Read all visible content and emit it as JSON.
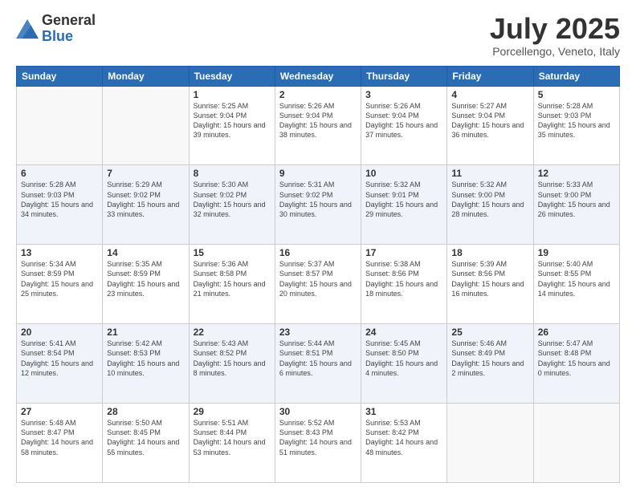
{
  "logo": {
    "general": "General",
    "blue": "Blue"
  },
  "header": {
    "month": "July 2025",
    "location": "Porcellengo, Veneto, Italy"
  },
  "weekdays": [
    "Sunday",
    "Monday",
    "Tuesday",
    "Wednesday",
    "Thursday",
    "Friday",
    "Saturday"
  ],
  "weeks": [
    [
      {
        "day": null,
        "sunrise": null,
        "sunset": null,
        "daylight": null
      },
      {
        "day": null,
        "sunrise": null,
        "sunset": null,
        "daylight": null
      },
      {
        "day": "1",
        "sunrise": "Sunrise: 5:25 AM",
        "sunset": "Sunset: 9:04 PM",
        "daylight": "Daylight: 15 hours and 39 minutes."
      },
      {
        "day": "2",
        "sunrise": "Sunrise: 5:26 AM",
        "sunset": "Sunset: 9:04 PM",
        "daylight": "Daylight: 15 hours and 38 minutes."
      },
      {
        "day": "3",
        "sunrise": "Sunrise: 5:26 AM",
        "sunset": "Sunset: 9:04 PM",
        "daylight": "Daylight: 15 hours and 37 minutes."
      },
      {
        "day": "4",
        "sunrise": "Sunrise: 5:27 AM",
        "sunset": "Sunset: 9:04 PM",
        "daylight": "Daylight: 15 hours and 36 minutes."
      },
      {
        "day": "5",
        "sunrise": "Sunrise: 5:28 AM",
        "sunset": "Sunset: 9:03 PM",
        "daylight": "Daylight: 15 hours and 35 minutes."
      }
    ],
    [
      {
        "day": "6",
        "sunrise": "Sunrise: 5:28 AM",
        "sunset": "Sunset: 9:03 PM",
        "daylight": "Daylight: 15 hours and 34 minutes."
      },
      {
        "day": "7",
        "sunrise": "Sunrise: 5:29 AM",
        "sunset": "Sunset: 9:02 PM",
        "daylight": "Daylight: 15 hours and 33 minutes."
      },
      {
        "day": "8",
        "sunrise": "Sunrise: 5:30 AM",
        "sunset": "Sunset: 9:02 PM",
        "daylight": "Daylight: 15 hours and 32 minutes."
      },
      {
        "day": "9",
        "sunrise": "Sunrise: 5:31 AM",
        "sunset": "Sunset: 9:02 PM",
        "daylight": "Daylight: 15 hours and 30 minutes."
      },
      {
        "day": "10",
        "sunrise": "Sunrise: 5:32 AM",
        "sunset": "Sunset: 9:01 PM",
        "daylight": "Daylight: 15 hours and 29 minutes."
      },
      {
        "day": "11",
        "sunrise": "Sunrise: 5:32 AM",
        "sunset": "Sunset: 9:00 PM",
        "daylight": "Daylight: 15 hours and 28 minutes."
      },
      {
        "day": "12",
        "sunrise": "Sunrise: 5:33 AM",
        "sunset": "Sunset: 9:00 PM",
        "daylight": "Daylight: 15 hours and 26 minutes."
      }
    ],
    [
      {
        "day": "13",
        "sunrise": "Sunrise: 5:34 AM",
        "sunset": "Sunset: 8:59 PM",
        "daylight": "Daylight: 15 hours and 25 minutes."
      },
      {
        "day": "14",
        "sunrise": "Sunrise: 5:35 AM",
        "sunset": "Sunset: 8:59 PM",
        "daylight": "Daylight: 15 hours and 23 minutes."
      },
      {
        "day": "15",
        "sunrise": "Sunrise: 5:36 AM",
        "sunset": "Sunset: 8:58 PM",
        "daylight": "Daylight: 15 hours and 21 minutes."
      },
      {
        "day": "16",
        "sunrise": "Sunrise: 5:37 AM",
        "sunset": "Sunset: 8:57 PM",
        "daylight": "Daylight: 15 hours and 20 minutes."
      },
      {
        "day": "17",
        "sunrise": "Sunrise: 5:38 AM",
        "sunset": "Sunset: 8:56 PM",
        "daylight": "Daylight: 15 hours and 18 minutes."
      },
      {
        "day": "18",
        "sunrise": "Sunrise: 5:39 AM",
        "sunset": "Sunset: 8:56 PM",
        "daylight": "Daylight: 15 hours and 16 minutes."
      },
      {
        "day": "19",
        "sunrise": "Sunrise: 5:40 AM",
        "sunset": "Sunset: 8:55 PM",
        "daylight": "Daylight: 15 hours and 14 minutes."
      }
    ],
    [
      {
        "day": "20",
        "sunrise": "Sunrise: 5:41 AM",
        "sunset": "Sunset: 8:54 PM",
        "daylight": "Daylight: 15 hours and 12 minutes."
      },
      {
        "day": "21",
        "sunrise": "Sunrise: 5:42 AM",
        "sunset": "Sunset: 8:53 PM",
        "daylight": "Daylight: 15 hours and 10 minutes."
      },
      {
        "day": "22",
        "sunrise": "Sunrise: 5:43 AM",
        "sunset": "Sunset: 8:52 PM",
        "daylight": "Daylight: 15 hours and 8 minutes."
      },
      {
        "day": "23",
        "sunrise": "Sunrise: 5:44 AM",
        "sunset": "Sunset: 8:51 PM",
        "daylight": "Daylight: 15 hours and 6 minutes."
      },
      {
        "day": "24",
        "sunrise": "Sunrise: 5:45 AM",
        "sunset": "Sunset: 8:50 PM",
        "daylight": "Daylight: 15 hours and 4 minutes."
      },
      {
        "day": "25",
        "sunrise": "Sunrise: 5:46 AM",
        "sunset": "Sunset: 8:49 PM",
        "daylight": "Daylight: 15 hours and 2 minutes."
      },
      {
        "day": "26",
        "sunrise": "Sunrise: 5:47 AM",
        "sunset": "Sunset: 8:48 PM",
        "daylight": "Daylight: 15 hours and 0 minutes."
      }
    ],
    [
      {
        "day": "27",
        "sunrise": "Sunrise: 5:48 AM",
        "sunset": "Sunset: 8:47 PM",
        "daylight": "Daylight: 14 hours and 58 minutes."
      },
      {
        "day": "28",
        "sunrise": "Sunrise: 5:50 AM",
        "sunset": "Sunset: 8:45 PM",
        "daylight": "Daylight: 14 hours and 55 minutes."
      },
      {
        "day": "29",
        "sunrise": "Sunrise: 5:51 AM",
        "sunset": "Sunset: 8:44 PM",
        "daylight": "Daylight: 14 hours and 53 minutes."
      },
      {
        "day": "30",
        "sunrise": "Sunrise: 5:52 AM",
        "sunset": "Sunset: 8:43 PM",
        "daylight": "Daylight: 14 hours and 51 minutes."
      },
      {
        "day": "31",
        "sunrise": "Sunrise: 5:53 AM",
        "sunset": "Sunset: 8:42 PM",
        "daylight": "Daylight: 14 hours and 48 minutes."
      },
      {
        "day": null,
        "sunrise": null,
        "sunset": null,
        "daylight": null
      },
      {
        "day": null,
        "sunrise": null,
        "sunset": null,
        "daylight": null
      }
    ]
  ]
}
